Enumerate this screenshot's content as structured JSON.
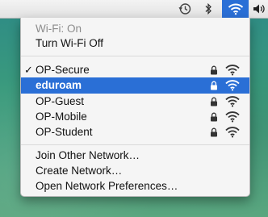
{
  "menubar": {
    "icons": [
      "time-machine-icon",
      "bluetooth-icon",
      "wifi-icon",
      "volume-icon"
    ],
    "wifi_highlight_color": "#2a6fd6"
  },
  "menu": {
    "status": "Wi-Fi: On",
    "toggle": "Turn Wi-Fi Off",
    "networks": [
      {
        "name": "OP-Secure",
        "connected": true,
        "locked": true,
        "signal": "full"
      },
      {
        "name": "eduroam",
        "connected": false,
        "locked": true,
        "signal": "full",
        "highlighted": true
      },
      {
        "name": "OP-Guest",
        "connected": false,
        "locked": true,
        "signal": "full"
      },
      {
        "name": "OP-Mobile",
        "connected": false,
        "locked": true,
        "signal": "full"
      },
      {
        "name": "OP-Student",
        "connected": false,
        "locked": true,
        "signal": "full"
      }
    ],
    "check_mark": "✓",
    "actions": [
      "Join Other Network…",
      "Create Network…",
      "Open Network Preferences…"
    ]
  }
}
